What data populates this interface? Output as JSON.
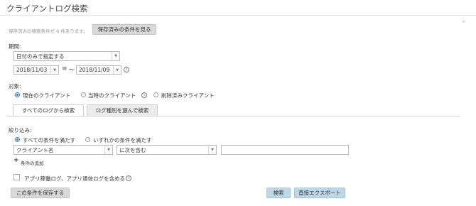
{
  "header": {
    "title": "クライアントログ検索",
    "collapse_icon": "chevron-up-icon"
  },
  "saved": {
    "note": "保存済みの検索条件が 6 件あります。",
    "button": "保存済みの条件を見る"
  },
  "period": {
    "label": "期間:",
    "mode": "日付のみで指定する",
    "start_date": "2018/11/03",
    "end_date": "2018/11/09",
    "tilde": "〜",
    "eq_icon": "≡"
  },
  "target": {
    "label": "対象:",
    "options": [
      "現在のクライアント",
      "当時のクライアント",
      "削除済みクライアント"
    ],
    "selected": 0
  },
  "tabs": [
    {
      "label": "すべてのログから検索",
      "active": true
    },
    {
      "label": "ログ種別を選んで検索",
      "active": false
    }
  ],
  "filter": {
    "label": "絞り込み:",
    "match_options": [
      "すべての条件を満たす",
      "いずれかの条件を満たす"
    ],
    "selected": 0,
    "field": "クライアント名",
    "operator": "に次を含む",
    "value": "",
    "add_condition": "条件の追加"
  },
  "include_app_logs": {
    "label": "アプリ稼働ログ、アプリ通信ログを含める",
    "checked": false
  },
  "actions": {
    "save": "この条件を保存する",
    "search": "検索",
    "export": "直接エクスポート"
  },
  "colors": {
    "accent": "#2b7bc4",
    "primary_button": "#bfd7e6",
    "secondary_button": "#d9d9d9"
  }
}
